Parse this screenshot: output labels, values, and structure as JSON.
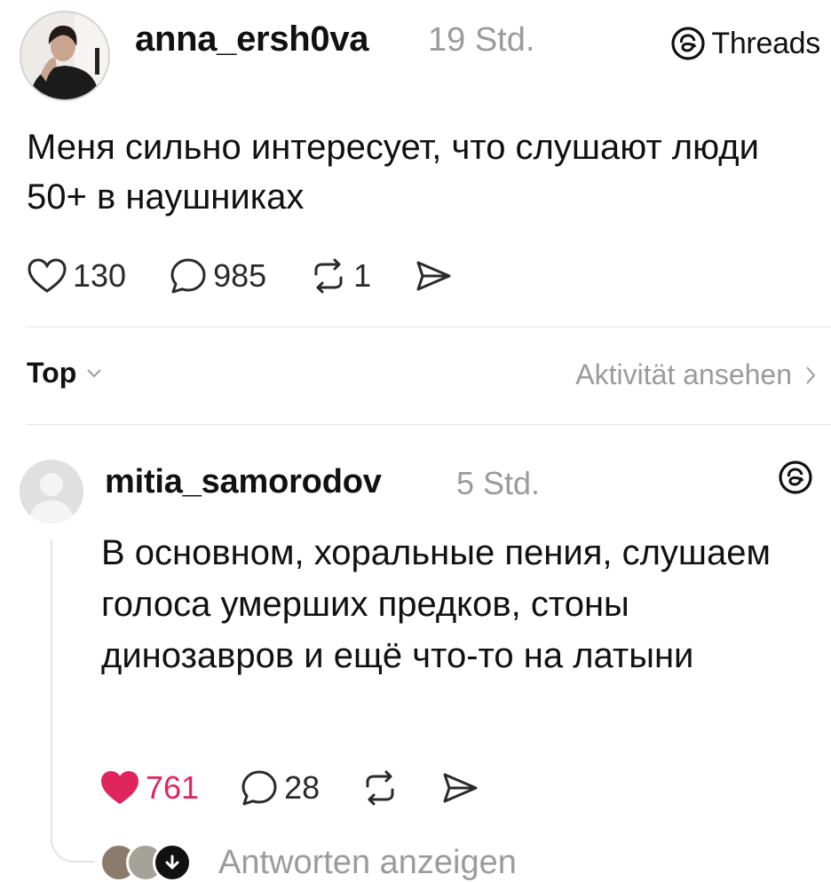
{
  "post": {
    "username": "anna_ersh0va",
    "time": "19 Std.",
    "app_label": "Threads",
    "text": "Меня сильно интересует, что слушают люди 50+ в наушниках",
    "likes": "130",
    "comments": "985",
    "reposts": "1"
  },
  "sort": {
    "label": "Top",
    "activity_label": "Aktivität ansehen"
  },
  "reply": {
    "username": "mitia_samorodov",
    "time": "5 Std.",
    "text": "В основном, хоральные пения, слушаем голоса умерших предков, стоны динозавров и ещё что-то на латыни",
    "likes": "761",
    "comments": "28",
    "show_replies_label": "Antworten anzeigen"
  },
  "colors": {
    "like_active": "#e0245e",
    "muted_text": "#9b9b9b",
    "divider": "#e6e6e6"
  },
  "icons": {
    "threads": "threads-logo-icon",
    "like": "heart-icon",
    "comment": "comment-bubble-icon",
    "repost": "repost-icon",
    "share": "send-icon",
    "chevron_down": "chevron-down-icon",
    "chevron_right": "chevron-right-icon"
  }
}
